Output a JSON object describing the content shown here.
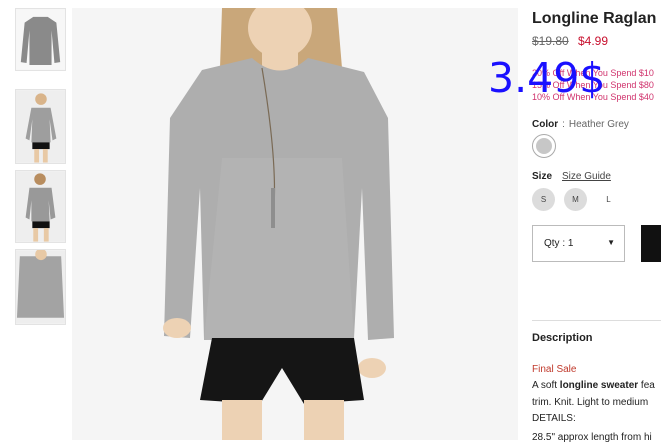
{
  "product": {
    "title": "Longline Raglan",
    "price_old": "$19.80",
    "price_new": "$4.99",
    "promos": [
      "20% Off When You Spend $10",
      "15% Off When You Spend $80",
      "10% Off When You Spend $40"
    ]
  },
  "color": {
    "label": "Color",
    "separator": ":",
    "value": "Heather Grey",
    "swatch_color": "#c7c7c7"
  },
  "size": {
    "label": "Size",
    "guide": "Size Guide",
    "options": [
      "S",
      "M",
      "L"
    ]
  },
  "quantity": {
    "label": "Qty : 1",
    "caret": "▼"
  },
  "description": {
    "title": "Description",
    "final_sale": "Final Sale",
    "line1_prefix": "A soft ",
    "line1_bold": "longline sweater",
    "line1_suffix": " fea",
    "line2": "trim. Knit. Light to medium",
    "line3": "DETAILS:",
    "line4": "28.5\" approx length from hi"
  },
  "overlay_text": "3.49$",
  "colors": {
    "sale_red": "#c8102e",
    "promo_pink": "#d0336d",
    "overlay_blue": "#1a10ff",
    "button_black": "#111111"
  }
}
